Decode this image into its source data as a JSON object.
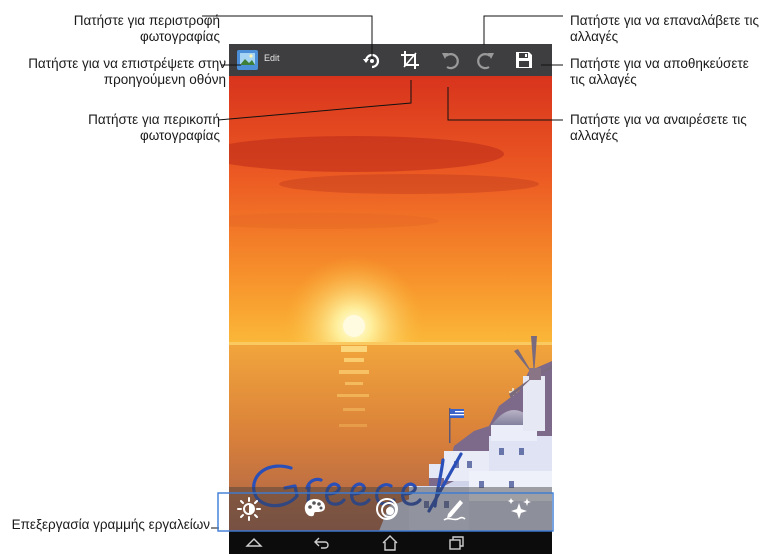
{
  "screen": {
    "app_title": "Edit",
    "photo_signature_text": "Greece!"
  },
  "callouts": {
    "rotate": "Πατήστε για περιστροφή φωτογραφίας",
    "back": "Πατήστε για να επιστρέψετε στην προηγούμενη οθόνη",
    "crop": "Πατήστε για περικοπή φωτογραφίας",
    "redo": "Πατήστε για να επαναλάβετε τις αλλαγές",
    "save": "Πατήστε για να αποθηκεύσετε τις αλλαγές",
    "undo": "Πατήστε για να αναιρέσετε τις αλλαγές",
    "toolbar": "Επεξεργασία γραμμής εργαλείων"
  },
  "icons": {
    "actionbar": [
      "rotate-icon",
      "crop-icon",
      "undo-icon",
      "redo-icon",
      "save-icon"
    ],
    "toolbar": [
      "brightness-icon",
      "palette-icon",
      "effects-icon",
      "draw-icon",
      "sparkle-icon"
    ],
    "navbar": [
      "menu-up-icon",
      "back-icon",
      "home-icon",
      "recent-apps-icon"
    ]
  },
  "colors": {
    "actionbar_bg": "#3e3e40",
    "callout_box": "#3b7bd6",
    "signature": "#2a4fb8"
  }
}
